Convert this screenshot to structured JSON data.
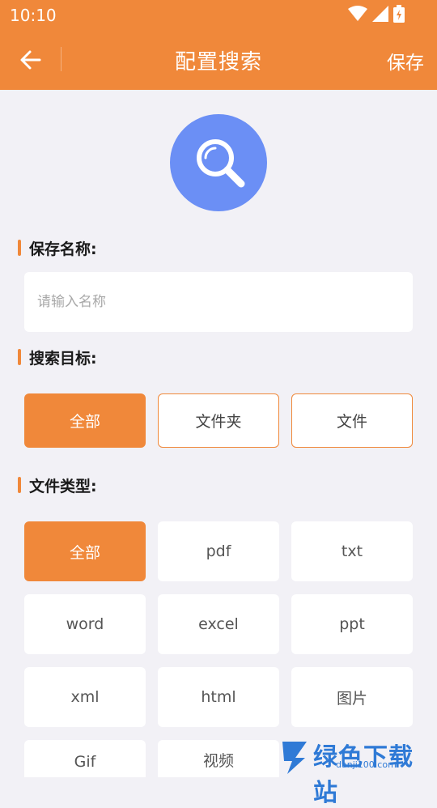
{
  "status_bar": {
    "time": "10:10"
  },
  "header": {
    "title": "配置搜索",
    "save_label": "保存"
  },
  "sections": {
    "name": {
      "label": "保存名称:",
      "placeholder": "请输入名称",
      "value": ""
    },
    "target": {
      "label": "搜索目标:",
      "options": [
        "全部",
        "文件夹",
        "文件"
      ],
      "selected": "全部"
    },
    "file_type": {
      "label": "文件类型:",
      "options": [
        "全部",
        "pdf",
        "txt",
        "word",
        "excel",
        "ppt",
        "xml",
        "html",
        "图片",
        "Gif",
        "视频"
      ],
      "selected": "全部"
    }
  },
  "watermark": {
    "text": "绿色下载站",
    "url": "danji100.com"
  },
  "colors": {
    "accent": "#f0883a",
    "hero": "#6b8ff5",
    "background": "#f2f1f6"
  },
  "icons": [
    "wifi-icon",
    "signal-icon",
    "battery-icon",
    "back-arrow-icon",
    "search-icon"
  ]
}
